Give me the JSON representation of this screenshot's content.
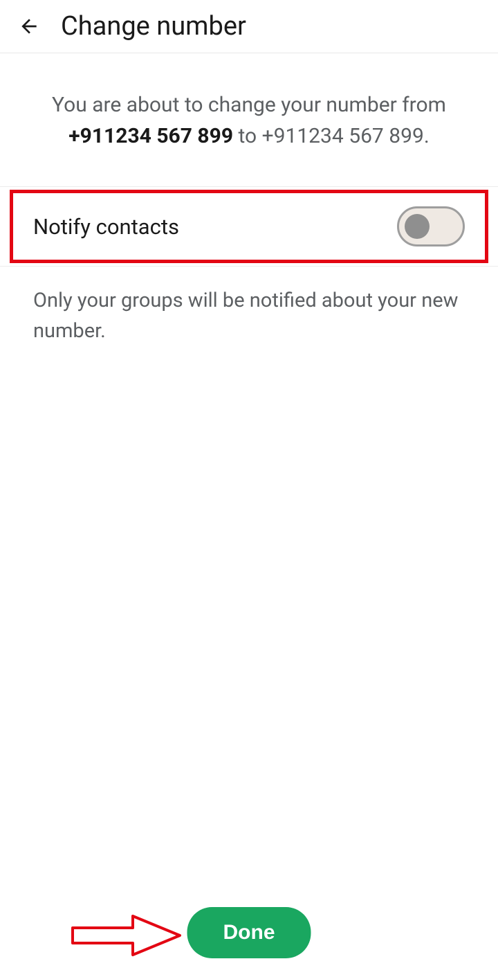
{
  "header": {
    "title": "Change number"
  },
  "info": {
    "prefix": "You are about to change your number from ",
    "old_number": "+911234 567 899",
    "middle": " to ",
    "new_number": "+911234 567 899",
    "suffix": "."
  },
  "notify": {
    "label": "Notify contacts"
  },
  "subtext": "Only your groups will be notified about your new number.",
  "done_label": "Done"
}
